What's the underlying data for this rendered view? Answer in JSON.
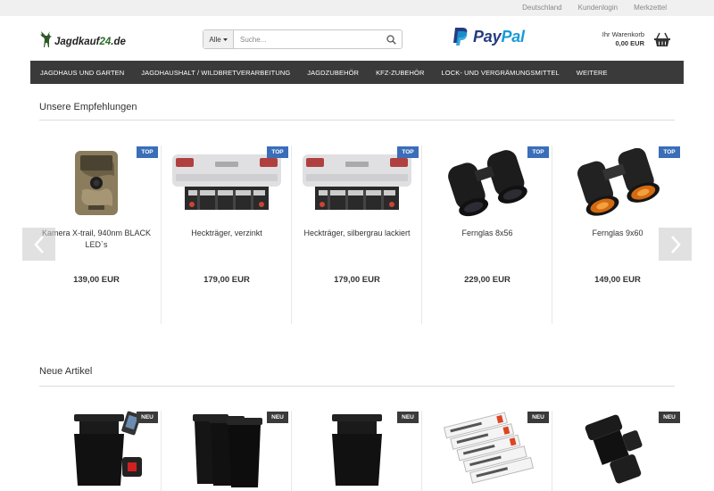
{
  "topbar": {
    "links": [
      "Deutschland",
      "Kundenlogin",
      "Merkzettel"
    ]
  },
  "header": {
    "logo_text": "Jagdkauf",
    "logo_number": "24",
    "logo_suffix": ".de",
    "search": {
      "category": "Alle",
      "placeholder": "Suche..."
    },
    "paypal": {
      "pay": "Pay",
      "pal": "Pal"
    },
    "cart": {
      "label": "Ihr Warenkorb",
      "amount": "0,00 EUR"
    }
  },
  "nav": {
    "items": [
      "JAGDHAUS UND GARTEN",
      "JAGDHAUSHALT / WILDBRETVERARBEITUNG",
      "JAGDZUBEHÖR",
      "KFZ-ZUBEHÖR",
      "LOCK- UND VERGRÄMUNGSMITTEL",
      "WEITERE"
    ]
  },
  "recommendations": {
    "title": "Unsere Empfehlungen",
    "badge": "TOP",
    "products": [
      {
        "name": "Kamera X-trail, 940nm BLACK LED`s",
        "price": "139,00 EUR",
        "icon": "trail-camera"
      },
      {
        "name": "Heckträger, verzinkt",
        "price": "179,00 EUR",
        "icon": "car-rear-carrier"
      },
      {
        "name": "Heckträger, silbergrau lackiert",
        "price": "179,00 EUR",
        "icon": "car-rear-carrier"
      },
      {
        "name": "Fernglas 8x56",
        "price": "229,00 EUR",
        "icon": "binoculars"
      },
      {
        "name": "Fernglas 9x60",
        "price": "149,00 EUR",
        "icon": "binoculars-orange"
      }
    ]
  },
  "new_items": {
    "title": "Neue Artikel",
    "badge": "NEU",
    "products": [
      {
        "icon": "feeder-with-battery"
      },
      {
        "icon": "feeder-set"
      },
      {
        "icon": "feeder"
      },
      {
        "icon": "labels"
      },
      {
        "icon": "feeder-parts"
      }
    ]
  },
  "colors": {
    "nav_bg": "#3a3a3a",
    "top_badge": "#3a6eb8",
    "neu_badge": "#3a3a3a",
    "topbar_bg": "#f0f0f0"
  }
}
